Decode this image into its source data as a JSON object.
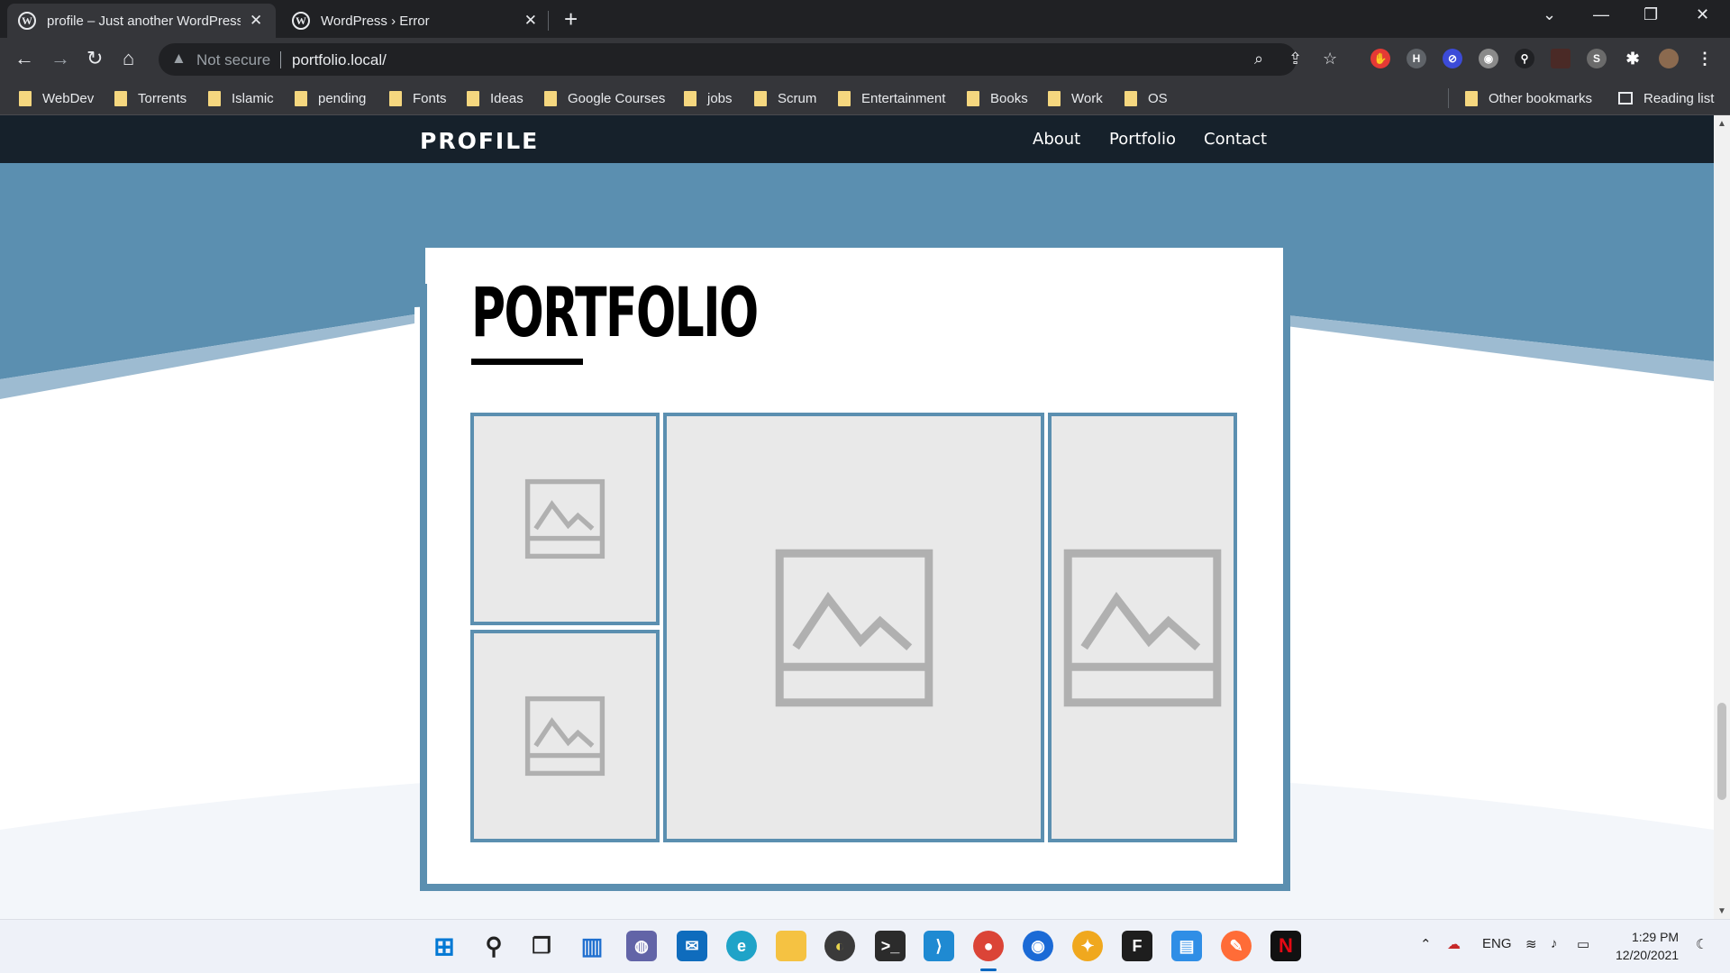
{
  "browser": {
    "tabs": [
      {
        "title": "profile – Just another WordPress",
        "active": true
      },
      {
        "title": "WordPress › Error",
        "active": false
      }
    ],
    "omnibox": {
      "security": "Not secure",
      "url": "portfolio.local/"
    },
    "bookmarks": [
      "WebDev",
      "Torrents",
      "Islamic",
      "pending",
      "Fonts",
      "Ideas",
      "Google Courses",
      "jobs",
      "Scrum",
      "Entertainment",
      "Books",
      "Work",
      "OS"
    ],
    "other_bookmarks": "Other bookmarks",
    "reading_list": "Reading list"
  },
  "site": {
    "logo": "PROFILE",
    "nav": [
      "About",
      "Portfolio",
      "Contact"
    ],
    "section_title": "PORTFOLIO",
    "colors": {
      "header": "#16212b",
      "accent": "#5b8fb0",
      "tile_bg": "#e9e9e9",
      "placeholder_icon": "#b0b0b0"
    },
    "portfolio_items": [
      {
        "icon": "image-placeholder-icon"
      },
      {
        "icon": "image-placeholder-icon"
      },
      {
        "icon": "image-placeholder-icon"
      },
      {
        "icon": "image-placeholder-icon"
      }
    ]
  },
  "taskbar": {
    "apps": [
      "windows-start",
      "search",
      "task-view",
      "widgets",
      "teams-chat",
      "mail",
      "edge",
      "file-explorer",
      "app-circle",
      "terminal",
      "vscode",
      "chrome",
      "firefox",
      "app-bird",
      "figma",
      "notepad",
      "postman",
      "netflix"
    ],
    "language": "ENG",
    "time": "1:29 PM",
    "date": "12/20/2021"
  }
}
